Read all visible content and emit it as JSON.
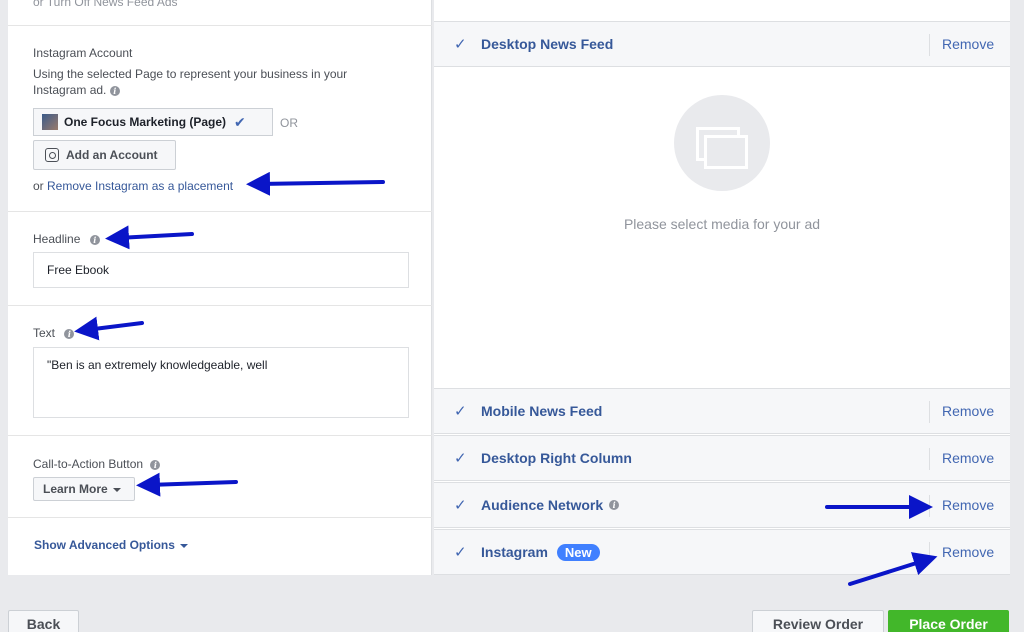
{
  "left": {
    "top_cut_text": "or Turn Off News Feed Ads",
    "instagram": {
      "label": "Instagram Account",
      "description": "Using the selected Page to represent your business in your Instagram ad.",
      "page_name": "One Focus Marketing (Page)",
      "or": "OR",
      "add_account": "Add an Account",
      "remove_prefix": "or ",
      "remove_link": "Remove Instagram as a placement"
    },
    "headline": {
      "label": "Headline",
      "value": "Free Ebook"
    },
    "text": {
      "label": "Text",
      "value": "\"Ben is an extremely knowledgeable, well"
    },
    "cta": {
      "label": "Call-to-Action Button",
      "value": "Learn More"
    },
    "advanced": "Show Advanced Options"
  },
  "right": {
    "placements": [
      {
        "name": "Desktop News Feed",
        "remove": "Remove"
      },
      {
        "name": "Mobile News Feed",
        "remove": "Remove"
      },
      {
        "name": "Desktop Right Column",
        "remove": "Remove"
      },
      {
        "name": "Audience Network",
        "remove": "Remove"
      },
      {
        "name": "Instagram",
        "badge": "New",
        "remove": "Remove"
      }
    ],
    "preview_text": "Please select media for your ad"
  },
  "footer": {
    "back": "Back",
    "review": "Review Order",
    "place": "Place Order"
  },
  "colors": {
    "link": "#365899",
    "accent": "#4267b2",
    "place_order": "#42b72a",
    "annotation_arrow": "#0a15c8"
  }
}
